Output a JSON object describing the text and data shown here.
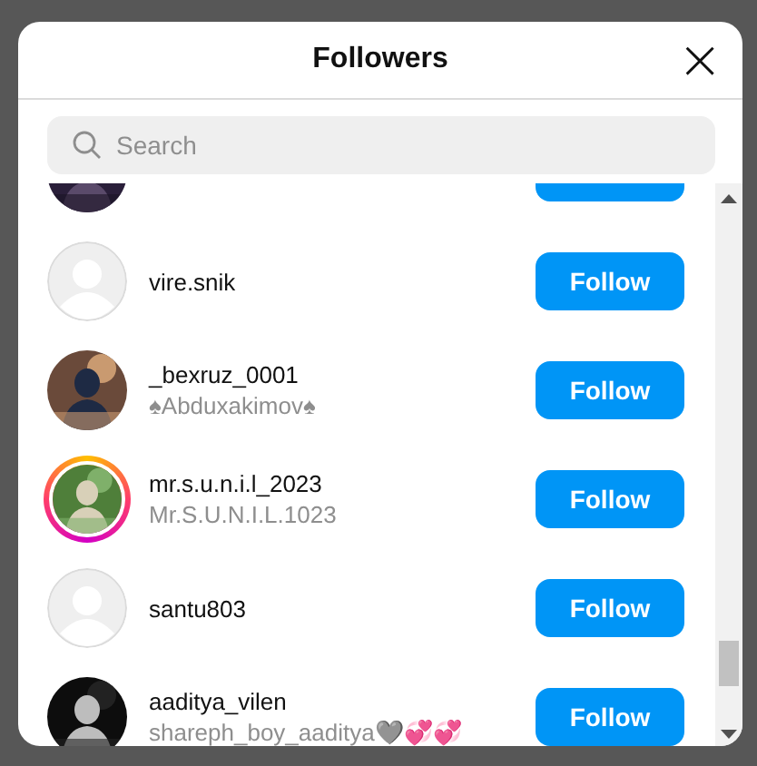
{
  "dialog": {
    "title": "Followers",
    "close": "×"
  },
  "search": {
    "placeholder": "Search"
  },
  "followers": [
    {
      "kind": "picture",
      "story": false
    },
    {
      "username": "vire.snik",
      "kind": "default",
      "story": false,
      "button": "Follow"
    },
    {
      "username": "_bexruz_0001",
      "name": "♠Abduxakimov♠",
      "kind": "picture",
      "story": false,
      "button": "Follow"
    },
    {
      "username": "mr.s.u.n.i.l_2023",
      "name": "Mr.S.U.N.I.L.1023",
      "kind": "picture",
      "story": true,
      "button": "Follow"
    },
    {
      "username": "santu803",
      "kind": "default",
      "story": false,
      "button": "Follow"
    },
    {
      "username": "aaditya_vilen",
      "name": "shareph_boy_aaditya🩶💞💞",
      "kind": "picture",
      "story": false,
      "button": "Follow"
    }
  ]
}
